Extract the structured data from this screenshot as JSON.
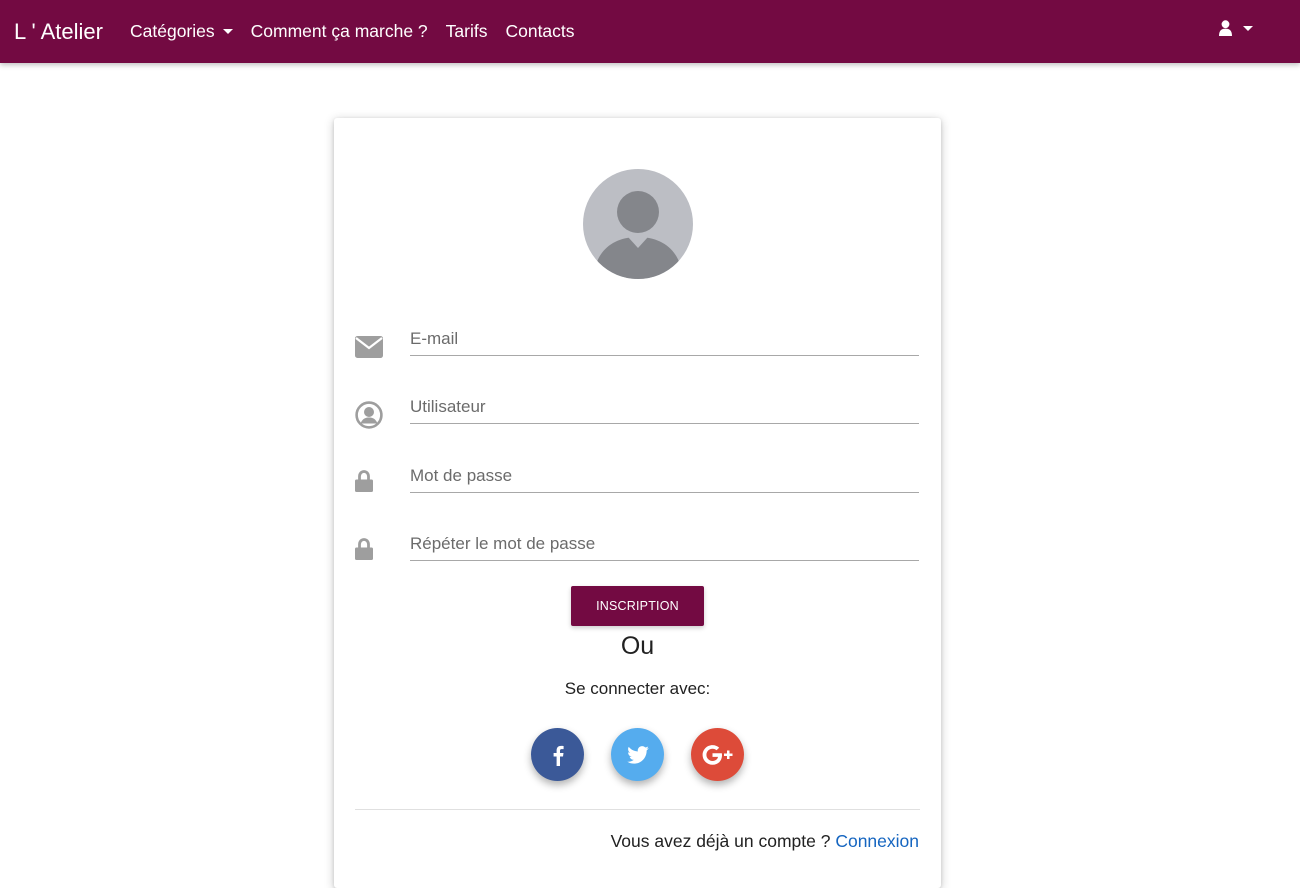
{
  "navbar": {
    "brand": "L ' Atelier",
    "links": [
      {
        "label": "Catégories"
      },
      {
        "label": "Comment ça marche ?"
      },
      {
        "label": "Tarifs"
      },
      {
        "label": "Contacts"
      }
    ],
    "user_icon": "user-icon"
  },
  "form": {
    "avatar_icon": "avatar-placeholder-icon",
    "fields": [
      {
        "placeholder": "E-mail",
        "icon": "envelope-icon"
      },
      {
        "placeholder": "Utilisateur",
        "icon": "user-circle-icon"
      },
      {
        "placeholder": "Mot de passe",
        "icon": "lock-icon"
      },
      {
        "placeholder": "Répéter le mot de passe",
        "icon": "lock-icon"
      }
    ],
    "submit_label": "INSCRIPTION",
    "or_label": "Ou",
    "connect_with": "Se connecter avec:",
    "socials": [
      {
        "name": "facebook",
        "icon": "facebook-icon",
        "color": "#3b5998"
      },
      {
        "name": "twitter",
        "icon": "twitter-icon",
        "color": "#55acee"
      },
      {
        "name": "google-plus",
        "icon": "google-plus-icon",
        "color": "#dd4b39"
      }
    ],
    "account_prompt": "Vous avez déjà un compte ?",
    "login_link": "Connexion"
  },
  "colors": {
    "brand": "#730a42",
    "link": "#1565c0"
  }
}
